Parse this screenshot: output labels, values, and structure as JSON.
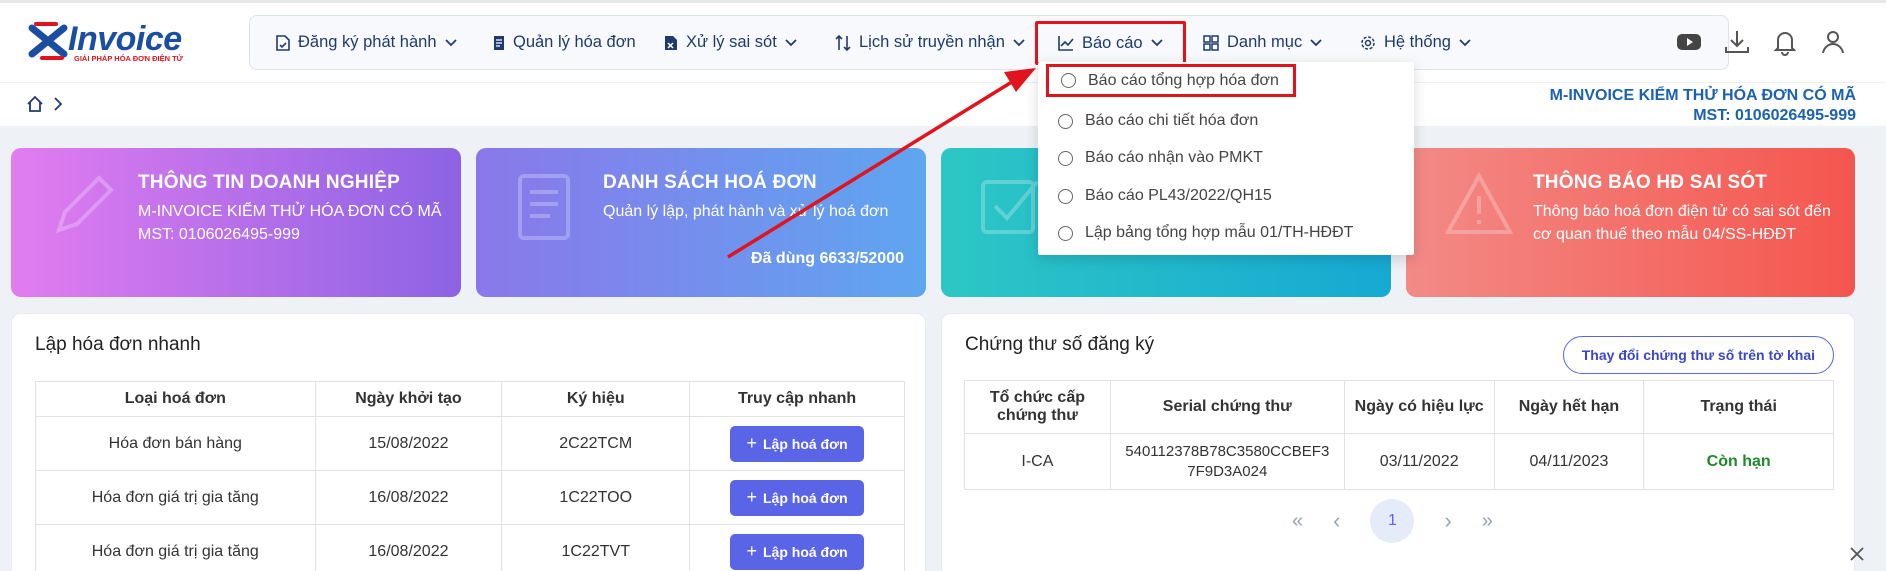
{
  "brand": {
    "name": "Invoice",
    "tagline": "GIẢI PHÁP HÓA ĐƠN ĐIỆN TỬ"
  },
  "nav": [
    {
      "label": "Đăng ký phát hành",
      "icon": "document-check-icon",
      "dropdown": true
    },
    {
      "label": "Quản lý hóa đơn",
      "icon": "document-icon",
      "dropdown": false
    },
    {
      "label": "Xử lý sai sót",
      "icon": "document-x-icon",
      "dropdown": true
    },
    {
      "label": "Lịch sử truyền nhận",
      "icon": "transfer-icon",
      "dropdown": true
    },
    {
      "label": "Báo cáo",
      "icon": "chart-icon",
      "dropdown": true
    },
    {
      "label": "Danh mục",
      "icon": "grid-icon",
      "dropdown": true
    },
    {
      "label": "Hệ thống",
      "icon": "gear-icon",
      "dropdown": true
    }
  ],
  "header_icons": [
    "youtube-icon",
    "download-icon",
    "bell-icon",
    "user-icon"
  ],
  "company": {
    "name": "M-INVOICE KIỂM THỬ HÓA ĐƠN CÓ MÃ",
    "mst": "MST: 0106026495-999"
  },
  "dropdown": {
    "items": [
      "Báo cáo tổng hợp hóa đơn",
      "Báo cáo chi tiết hóa đơn",
      "Báo cáo nhận vào PMKT",
      "Báo cáo PL43/2022/QH15",
      "Lập bảng tổng hợp mẫu 01/TH-HĐĐT"
    ]
  },
  "cards": [
    {
      "title": "THÔNG TIN DOANH NGHIỆP",
      "line1": "M-INVOICE KIỂM THỬ HÓA ĐƠN CÓ MÃ",
      "line2": "MST: 0106026495-999",
      "color_from": "#e27cf0",
      "color_to": "#8c63e4"
    },
    {
      "title": "DANH SÁCH HOÁ ĐƠN",
      "line1": "Quản lý lập, phát hành và xử lý hoá đơn",
      "footer": "Đã dùng 6633/52000",
      "color_from": "#8a78ea",
      "color_to": "#5ea6f0"
    },
    {
      "title": "",
      "line1": "",
      "color_from": "#2cc7c5",
      "color_to": "#16a9d3"
    },
    {
      "title": "THÔNG BÁO HĐ SAI SÓT",
      "line1": "Thông báo hoá đơn điện tử có sai sót đến",
      "line2": "cơ quan thuế theo mẫu 04/SS-HĐĐT",
      "color_from": "#f38a86",
      "color_to": "#f4564e"
    }
  ],
  "quick": {
    "title": "Lập hóa đơn nhanh",
    "headers": [
      "Loại hoá đơn",
      "Ngày khởi tạo",
      "Ký hiệu",
      "Truy cập nhanh"
    ],
    "rows": [
      {
        "type": "Hóa đơn bán hàng",
        "date": "15/08/2022",
        "code": "2C22TCM",
        "action": "Lập hoá đơn"
      },
      {
        "type": "Hóa đơn giá trị gia tăng",
        "date": "16/08/2022",
        "code": "1C22TOO",
        "action": "Lập hoá đơn"
      },
      {
        "type": "Hóa đơn giá trị gia tăng",
        "date": "16/08/2022",
        "code": "1C22TVT",
        "action": "Lập hoá đơn"
      }
    ]
  },
  "cert": {
    "title": "Chứng thư số đăng ký",
    "change_button": "Thay đổi chứng thư số trên tờ khai",
    "headers": [
      "Tổ chức cấp chứng thư",
      "Serial chứng thư",
      "Ngày có hiệu lực",
      "Ngày hết hạn",
      "Trạng thái"
    ],
    "rows": [
      {
        "org": "I-CA",
        "serial1": "540112378B78C3580CCBEF3",
        "serial2": "7F9D3A024",
        "from": "03/11/2022",
        "to": "04/11/2023",
        "status": "Còn hạn"
      }
    ],
    "pager": {
      "first": "«",
      "prev": "‹",
      "current": "1",
      "next": "›",
      "last": "»"
    }
  },
  "colors": {
    "accent": "#5a64e6",
    "highlight": "#e0141d",
    "nav_text": "#1f3b6e",
    "status_ok": "#1f8a2a"
  }
}
